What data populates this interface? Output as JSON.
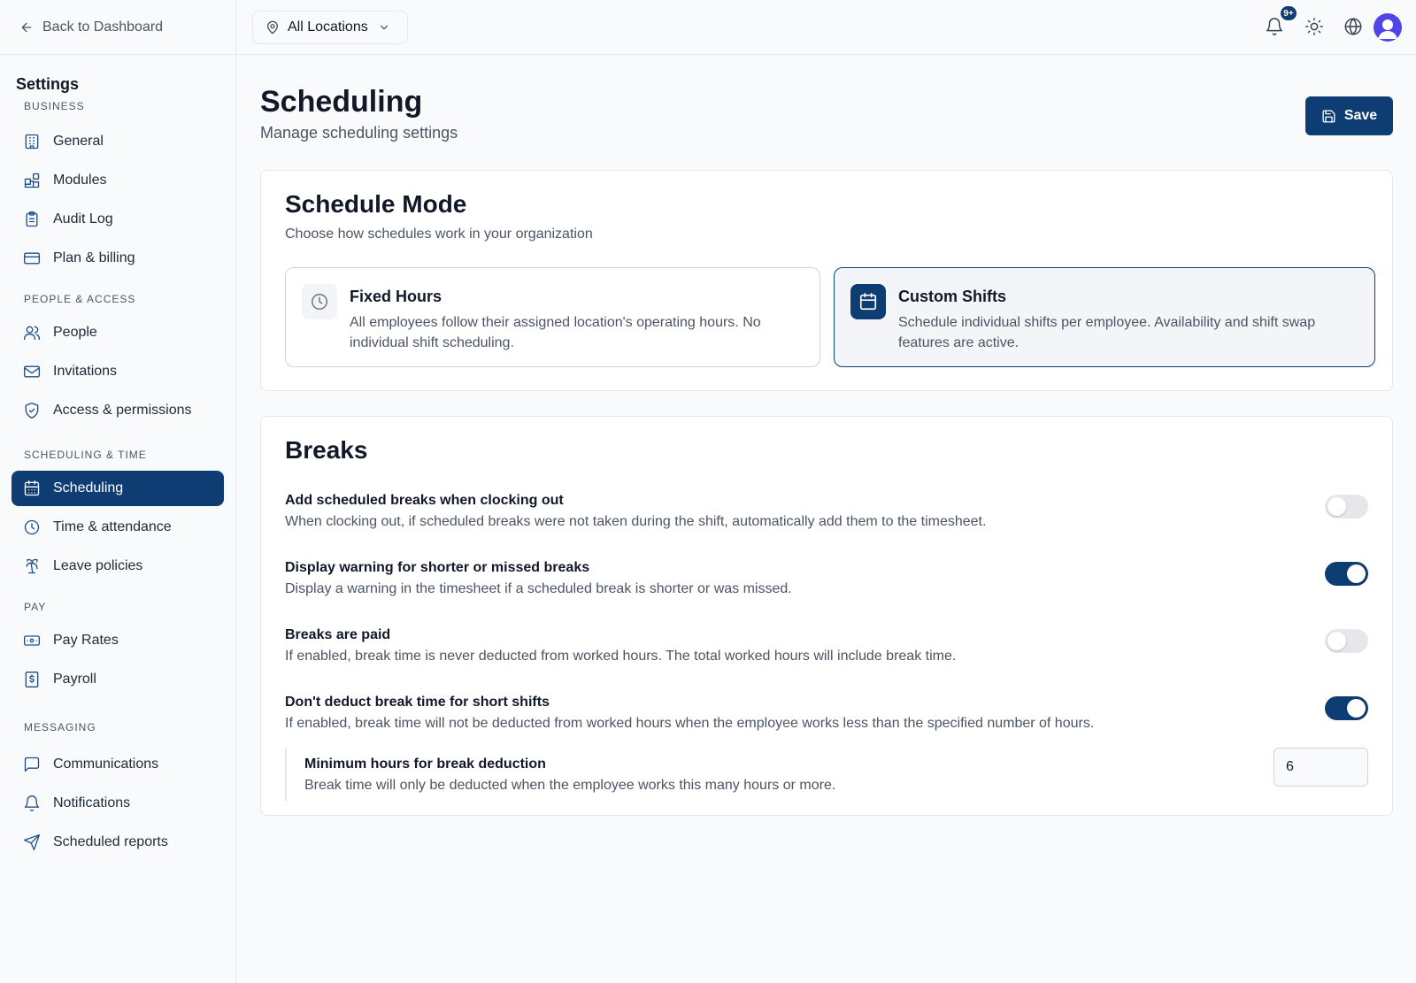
{
  "nav": {
    "back_label": "Back to Dashboard",
    "settings_title": "Settings",
    "sections": [
      {
        "label": "BUSINESS",
        "items": [
          {
            "label": "General",
            "icon": "building-icon"
          },
          {
            "label": "Modules",
            "icon": "modules-icon"
          },
          {
            "label": "Audit Log",
            "icon": "clipboard-icon"
          },
          {
            "label": "Plan & billing",
            "icon": "credit-card-icon"
          }
        ]
      },
      {
        "label": "PEOPLE & ACCESS",
        "items": [
          {
            "label": "People",
            "icon": "users-icon"
          },
          {
            "label": "Invitations",
            "icon": "mail-icon"
          },
          {
            "label": "Access & permissions",
            "icon": "shield-check-icon"
          }
        ]
      },
      {
        "label": "SCHEDULING & TIME",
        "items": [
          {
            "label": "Scheduling",
            "icon": "calendar-icon",
            "active": true
          },
          {
            "label": "Time & attendance",
            "icon": "clock-icon"
          },
          {
            "label": "Leave policies",
            "icon": "palm-tree-icon"
          }
        ]
      },
      {
        "label": "PAY",
        "items": [
          {
            "label": "Pay Rates",
            "icon": "banknote-icon"
          },
          {
            "label": "Payroll",
            "icon": "receipt-icon"
          }
        ]
      },
      {
        "label": "MESSAGING",
        "items": [
          {
            "label": "Communications",
            "icon": "message-square-icon"
          },
          {
            "label": "Notifications",
            "icon": "bell-icon"
          },
          {
            "label": "Scheduled reports",
            "icon": "send-icon"
          }
        ]
      }
    ]
  },
  "topbar": {
    "location_label": "All Locations",
    "notification_badge": "9+"
  },
  "page": {
    "title": "Scheduling",
    "subtitle": "Manage scheduling settings",
    "save_label": "Save"
  },
  "schedule_mode": {
    "title": "Schedule Mode",
    "subtitle": "Choose how schedules work in your organization",
    "options": [
      {
        "name": "Fixed Hours",
        "description": "All employees follow their assigned location's operating hours. No individual shift scheduling.",
        "selected": false
      },
      {
        "name": "Custom Shifts",
        "description": "Schedule individual shifts per employee. Availability and shift swap features are active.",
        "selected": true
      }
    ]
  },
  "breaks": {
    "title": "Breaks",
    "settings": [
      {
        "label": "Add scheduled breaks when clocking out",
        "description": "When clocking out, if scheduled breaks were not taken during the shift, automatically add them to the timesheet.",
        "enabled": false
      },
      {
        "label": "Display warning for shorter or missed breaks",
        "description": "Display a warning in the timesheet if a scheduled break is shorter or was missed.",
        "enabled": true
      },
      {
        "label": "Breaks are paid",
        "description": "If enabled, break time is never deducted from worked hours. The total worked hours will include break time.",
        "enabled": false
      },
      {
        "label": "Don't deduct break time for short shifts",
        "description": "If enabled, break time will not be deducted from worked hours when the employee works less than the specified number of hours.",
        "enabled": true
      }
    ],
    "min_hours": {
      "label": "Minimum hours for break deduction",
      "description": "Break time will only be deducted when the employee works this many hours or more.",
      "value": "6"
    }
  },
  "colors": {
    "accent": "#0e3d73",
    "icon": "#1e4f8a"
  }
}
